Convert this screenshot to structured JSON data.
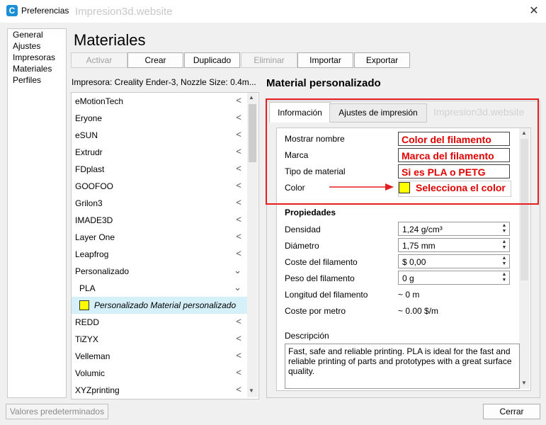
{
  "window": {
    "title": "Preferencias",
    "watermark": "Impresion3d.website",
    "icon_letter": "C"
  },
  "sidebar": {
    "items": [
      {
        "label": "General"
      },
      {
        "label": "Ajustes"
      },
      {
        "label": "Impresoras"
      },
      {
        "label": "Materiales"
      },
      {
        "label": "Perfiles"
      }
    ]
  },
  "header": {
    "title": "Materiales"
  },
  "toolbar": {
    "activar": "Activar",
    "crear": "Crear",
    "duplicado": "Duplicado",
    "eliminar": "Eliminar",
    "importar": "Importar",
    "exportar": "Exportar"
  },
  "printer_info": "Impresora: Creality Ender-3, Nozzle Size: 0.4m...",
  "material_list": [
    {
      "label": "eMotionTech",
      "chev": "<"
    },
    {
      "label": "Eryone",
      "chev": "<"
    },
    {
      "label": "eSUN",
      "chev": "<"
    },
    {
      "label": "Extrudr",
      "chev": "<"
    },
    {
      "label": "FDplast",
      "chev": "<"
    },
    {
      "label": "GOOFOO",
      "chev": "<"
    },
    {
      "label": "Grilon3",
      "chev": "<"
    },
    {
      "label": "IMADE3D",
      "chev": "<"
    },
    {
      "label": "Layer One",
      "chev": "<"
    },
    {
      "label": "Leapfrog",
      "chev": "<"
    },
    {
      "label": "Personalizado",
      "chev": "⌄"
    },
    {
      "label": "PLA",
      "chev": "⌄"
    },
    {
      "label": "Personalizado Material personalizado",
      "chev": ""
    },
    {
      "label": "REDD",
      "chev": "<"
    },
    {
      "label": "TiZYX",
      "chev": "<"
    },
    {
      "label": "Velleman",
      "chev": "<"
    },
    {
      "label": "Volumic",
      "chev": "<"
    },
    {
      "label": "XYZprinting",
      "chev": "<"
    }
  ],
  "panel": {
    "title": "Material personalizado",
    "tabs": [
      {
        "label": "Información"
      },
      {
        "label": "Ajustes de impresión"
      }
    ],
    "fields": {
      "mostrar_nombre": {
        "label": "Mostrar nombre",
        "value": "Color del filamento"
      },
      "marca": {
        "label": "Marca",
        "value": "Marca del filamento"
      },
      "tipo": {
        "label": "Tipo de material",
        "value": "Si es PLA o PETG"
      },
      "color": {
        "label": "Color",
        "annotation": "Selecciona el color"
      }
    },
    "properties": {
      "heading": "Propiedades",
      "densidad": {
        "label": "Densidad",
        "value": "1,24 g/cm³"
      },
      "diametro": {
        "label": "Diámetro",
        "value": "1,75 mm"
      },
      "coste": {
        "label": "Coste del filamento",
        "value": "$ 0,00"
      },
      "peso": {
        "label": "Peso del filamento",
        "value": "0 g"
      },
      "longitud": {
        "label": "Longitud del filamento",
        "value": "~ 0 m"
      },
      "coste_metro": {
        "label": "Coste por metro",
        "value": "~ 0.00 $/m"
      }
    },
    "description": {
      "heading": "Descripción",
      "text": "Fast, safe and reliable printing. PLA is ideal for the fast and reliable printing of parts and prototypes with a great surface quality."
    }
  },
  "footer": {
    "defaults": "Valores predeterminados",
    "close": "Cerrar"
  },
  "colors": {
    "selection": "#d6f0fa",
    "swatch": "#ffff00",
    "annotation": "#e41e1e",
    "accent": "#1a8fd6"
  }
}
